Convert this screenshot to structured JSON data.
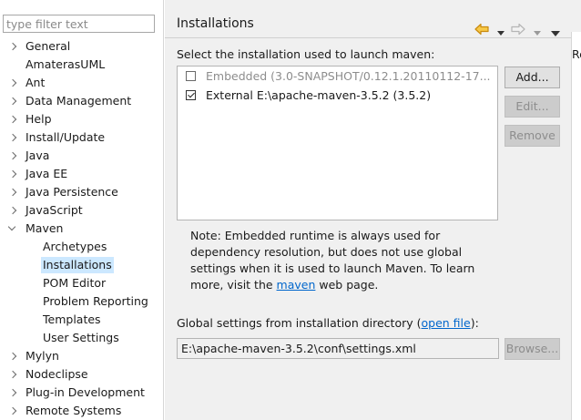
{
  "filter": {
    "placeholder": "type filter text"
  },
  "tree": {
    "items": [
      {
        "label": "General",
        "expander": "closed"
      },
      {
        "label": "AmaterasUML",
        "expander": "none"
      },
      {
        "label": "Ant",
        "expander": "closed"
      },
      {
        "label": "Data Management",
        "expander": "closed"
      },
      {
        "label": "Help",
        "expander": "closed"
      },
      {
        "label": "Install/Update",
        "expander": "closed"
      },
      {
        "label": "Java",
        "expander": "closed"
      },
      {
        "label": "Java EE",
        "expander": "closed"
      },
      {
        "label": "Java Persistence",
        "expander": "closed"
      },
      {
        "label": "JavaScript",
        "expander": "closed"
      },
      {
        "label": "Maven",
        "expander": "open"
      },
      {
        "label": "Archetypes",
        "child": true
      },
      {
        "label": "Installations",
        "child": true,
        "selected": true
      },
      {
        "label": "POM Editor",
        "child": true
      },
      {
        "label": "Problem Reporting",
        "child": true
      },
      {
        "label": "Templates",
        "child": true
      },
      {
        "label": "User Settings",
        "child": true
      },
      {
        "label": "Mylyn",
        "expander": "closed"
      },
      {
        "label": "Nodeclipse",
        "expander": "closed"
      },
      {
        "label": "Plug-in Development",
        "expander": "closed"
      },
      {
        "label": "Remote Systems",
        "expander": "closed"
      }
    ]
  },
  "page": {
    "title": "Installations",
    "section_label": "Select the installation used to launch maven:",
    "installations": [
      {
        "text": "Embedded (3.0-SNAPSHOT/0.12.1.20110112-17...",
        "checked": false,
        "disabled": true
      },
      {
        "text": "External E:\\apache-maven-3.5.2 (3.5.2)",
        "checked": true,
        "disabled": false
      }
    ],
    "buttons": {
      "add": "Add...",
      "edit": "Edit...",
      "remove": "Remove",
      "browse": "Browse..."
    },
    "note": {
      "before_link": "Note: Embedded runtime is always used for dependency resolution, but does not use global settings when it is used to launch Maven. To learn more, visit the ",
      "link": "maven",
      "after_link": " web page."
    },
    "global": {
      "before_link": "Global settings from installation directory (",
      "link": "open file",
      "after_link": "):",
      "path": "E:\\apache-maven-3.5.2\\conf\\settings.xml"
    }
  },
  "sliver": {
    "text": "Re"
  },
  "colors": {
    "selection": "#cce8ff",
    "link": "#0066cc",
    "back_arrow": "#e8a317",
    "panel_bg": "#f0f0f0"
  },
  "icons": {
    "back": "back-arrow-icon",
    "forward": "forward-arrow-icon",
    "menu": "view-menu-icon"
  }
}
